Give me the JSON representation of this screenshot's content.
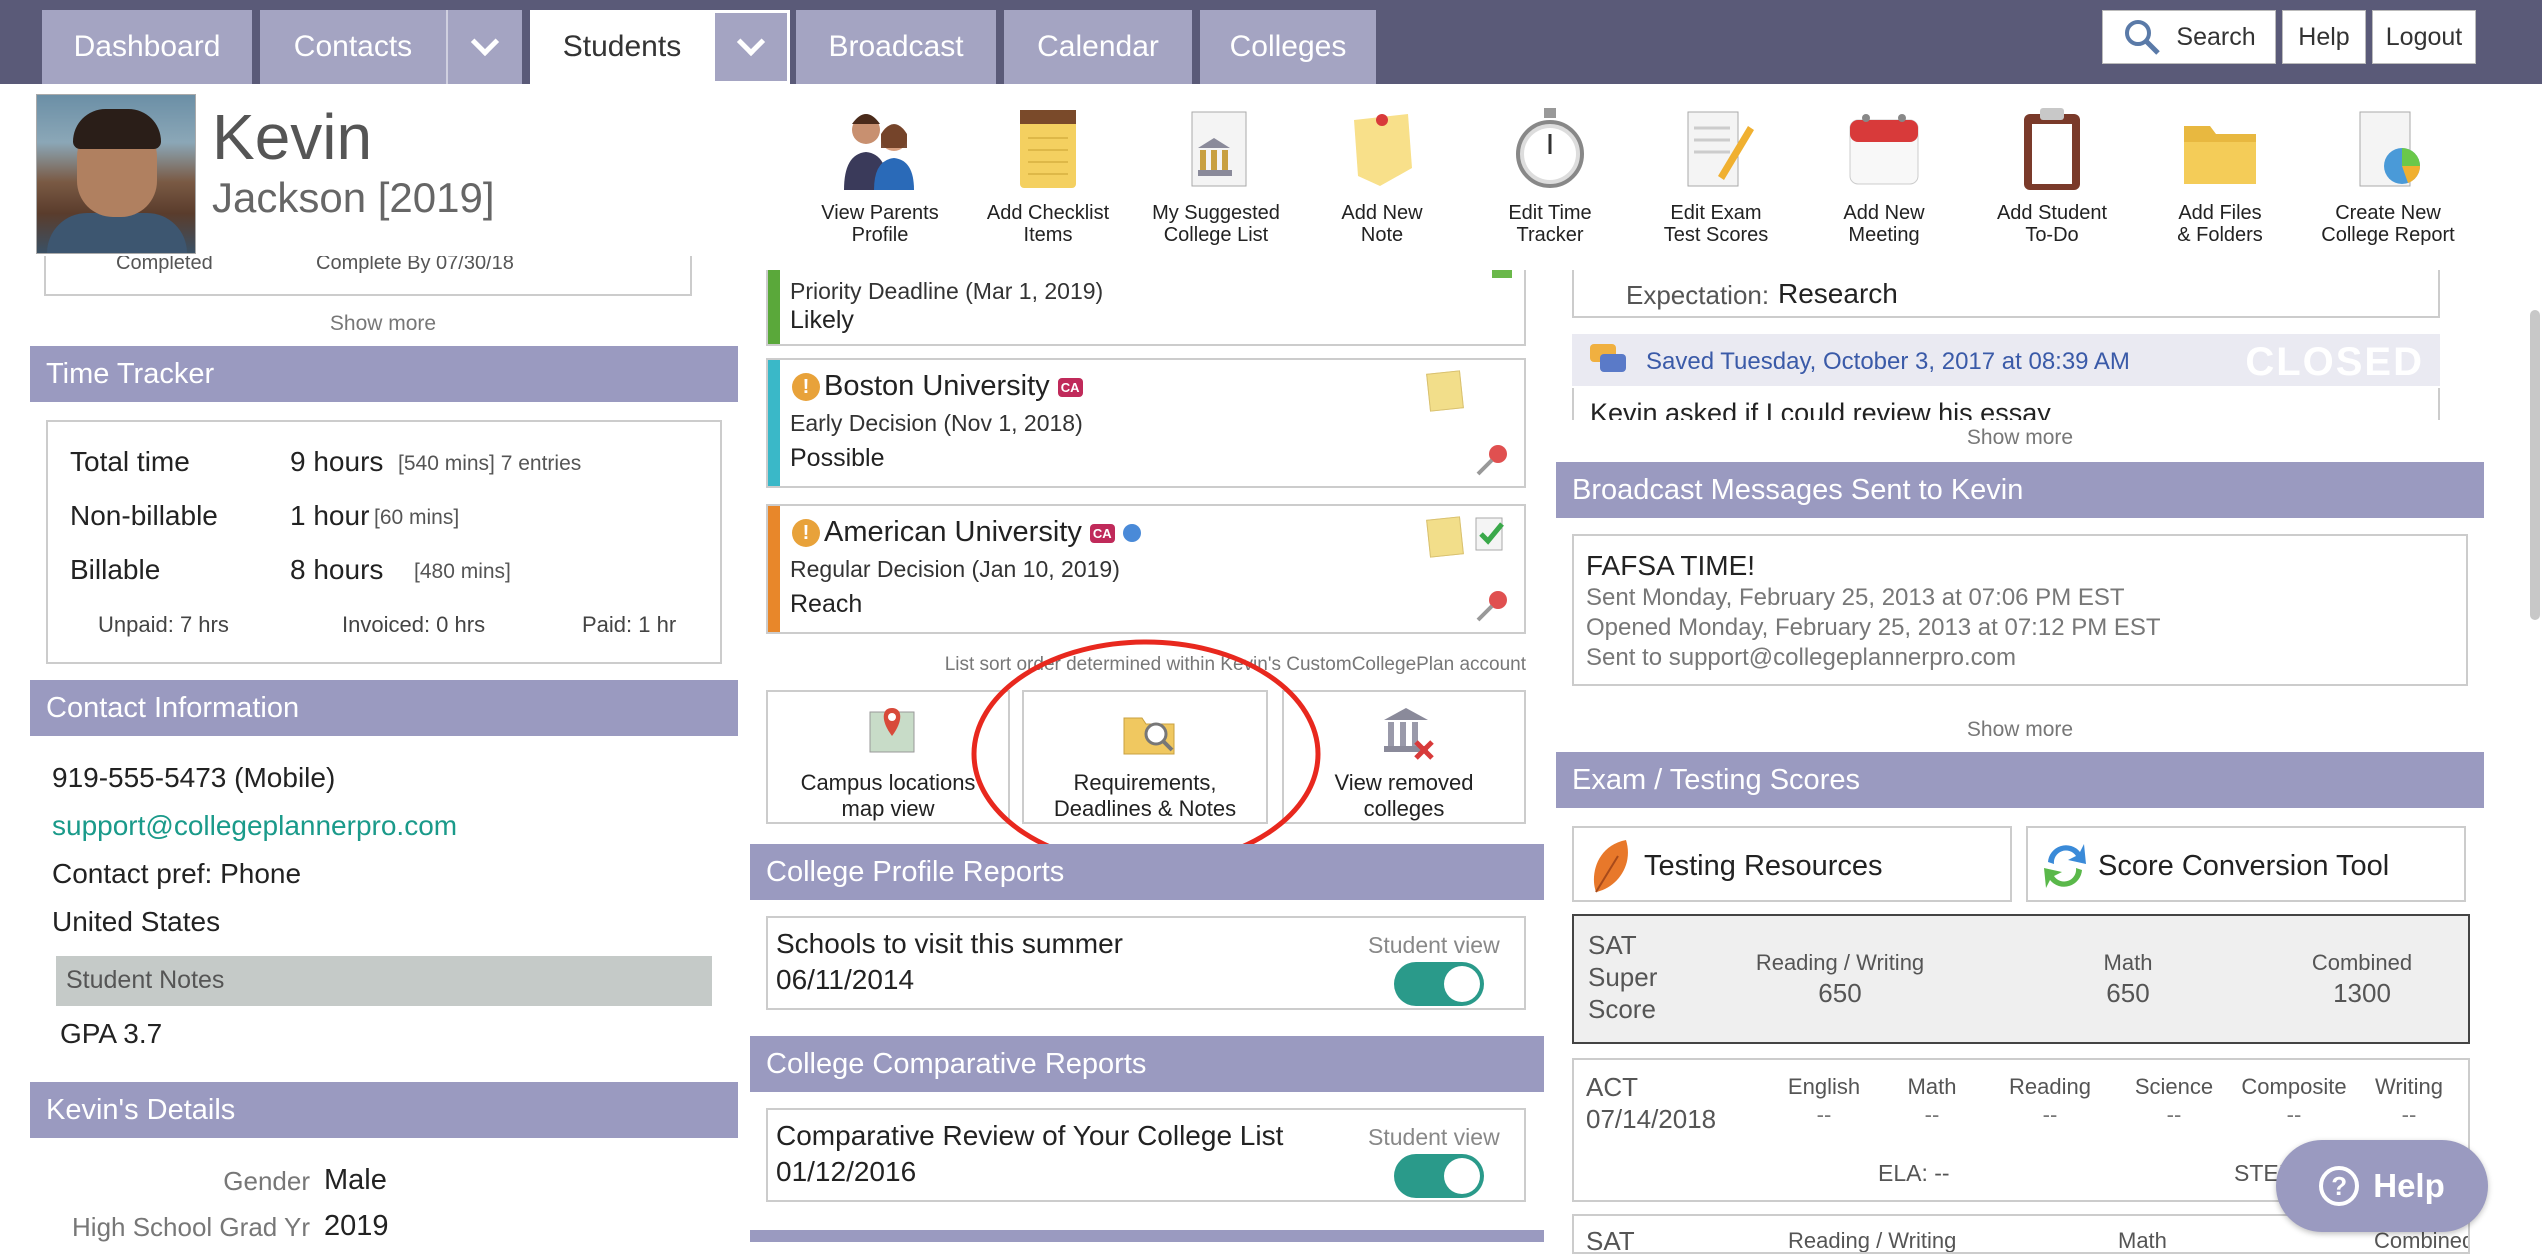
{
  "nav": {
    "tabs": [
      "Dashboard",
      "Contacts",
      "Students",
      "Broadcast",
      "Calendar",
      "Colleges"
    ],
    "search": "Search",
    "help": "Help",
    "logout": "Logout"
  },
  "student": {
    "first_name": "Kevin",
    "last_name": "Jackson [2019]"
  },
  "toolbar": [
    {
      "l1": "View Parents",
      "l2": "Profile",
      "icon": "parents-icon"
    },
    {
      "l1": "Add Checklist",
      "l2": "Items",
      "icon": "checklist-icon"
    },
    {
      "l1": "My Suggested",
      "l2": "College List",
      "icon": "college-list-icon"
    },
    {
      "l1": "Add New",
      "l2": "Note",
      "icon": "note-icon"
    },
    {
      "l1": "Edit Time",
      "l2": "Tracker",
      "icon": "stopwatch-icon"
    },
    {
      "l1": "Edit Exam",
      "l2": "Test Scores",
      "icon": "exam-icon"
    },
    {
      "l1": "Add New",
      "l2": "Meeting",
      "icon": "calendar-icon"
    },
    {
      "l1": "Add Student",
      "l2": "To-Do",
      "icon": "clipboard-icon"
    },
    {
      "l1": "Add Files",
      "l2": "& Folders",
      "icon": "folder-icon"
    },
    {
      "l1": "Create New",
      "l2": "College Report",
      "icon": "report-icon"
    }
  ],
  "left": {
    "partial_row": {
      "a": "Completed",
      "b": "Complete By 07/30/18"
    },
    "show_more": "Show more",
    "time_tracker": {
      "title": "Time Tracker",
      "rows": [
        {
          "label": "Total time",
          "value": "9 hours",
          "detail": "[540 mins] 7 entries"
        },
        {
          "label": "Non-billable",
          "value": "1 hour",
          "detail": "[60 mins]"
        },
        {
          "label": "Billable",
          "value": "8 hours",
          "detail": "[480 mins]"
        }
      ],
      "unpaid": "Unpaid: 7 hrs",
      "invoiced": "Invoiced: 0 hrs",
      "paid": "Paid: 1 hr"
    },
    "contact": {
      "title": "Contact Information",
      "phone": "919-555-5473 (Mobile)",
      "email": "support@collegeplannerpro.com",
      "pref": "Contact pref: Phone",
      "country": "United States",
      "notes_label": "Student Notes",
      "gpa": "GPA 3.7"
    },
    "details": {
      "title": "Kevin's Details",
      "gender_label": "Gender",
      "gender": "Male",
      "grad_label": "High School Grad Yr",
      "grad": "2019"
    }
  },
  "middle": {
    "colleges": [
      {
        "name": "",
        "deadline": "Priority Deadline (Mar 1, 2019)",
        "status": "Likely",
        "color": "#5aa83a"
      },
      {
        "name": "Boston University",
        "deadline": "Early Decision (Nov 1, 2018)",
        "status": "Possible",
        "color": "#3ab8c8"
      },
      {
        "name": "American University",
        "deadline": "Regular Decision (Jan 10, 2019)",
        "status": "Reach",
        "color": "#e8872a"
      }
    ],
    "sort_note": "List sort order determined within Kevin's CustomCollegePlan account",
    "actions": [
      {
        "l1": "Campus locations",
        "l2": "map view",
        "icon": "map-pin-icon"
      },
      {
        "l1": "Requirements,",
        "l2": "Deadlines & Notes",
        "icon": "folder-search-icon"
      },
      {
        "l1": "View removed",
        "l2": "colleges",
        "icon": "removed-college-icon"
      }
    ],
    "profile_reports": {
      "title": "College Profile Reports",
      "item": "Schools to visit this summer",
      "date": "06/11/2014",
      "student_view": "Student view"
    },
    "comparative_reports": {
      "title": "College Comparative Reports",
      "item": "Comparative Review of Your College List",
      "date": "01/12/2016",
      "student_view": "Student view"
    }
  },
  "right": {
    "expectation_label": "Expectation:",
    "expectation": "Research",
    "note_saved": "Saved Tuesday, October 3, 2017 at 08:39 AM",
    "closed": "CLOSED",
    "note_text": "Kevin asked if I could review his essay",
    "show_more": "Show more",
    "broadcast": {
      "title": "Broadcast Messages Sent to Kevin",
      "subject": "FAFSA TIME!",
      "sent": "Sent Monday, February 25, 2013 at 07:06 PM EST",
      "opened": "Opened Monday, February 25, 2013 at 07:12 PM EST",
      "to": "Sent to support@collegeplannerpro.com"
    },
    "exams": {
      "title": "Exam / Testing Scores",
      "resources": "Testing Resources",
      "conversion": "Score Conversion Tool",
      "sat": {
        "l1": "SAT",
        "l2": "Super",
        "l3": "Score",
        "rw_label": "Reading / Writing",
        "rw": "650",
        "math_label": "Math",
        "math": "650",
        "comb_label": "Combined",
        "comb": "1300"
      },
      "act": {
        "name": "ACT",
        "date": "07/14/2018",
        "cols": [
          "English",
          "Math",
          "Reading",
          "Science",
          "Composite",
          "Writing"
        ],
        "vals": [
          "--",
          "--",
          "--",
          "--",
          "--",
          "--"
        ],
        "ela": "ELA: --",
        "stem": "STEM: --"
      },
      "sat2": {
        "l1": "SAT",
        "rw_label": "Reading / Writing",
        "math_label": "Math",
        "comb_label": "Combined"
      }
    },
    "help_button": "Help"
  }
}
